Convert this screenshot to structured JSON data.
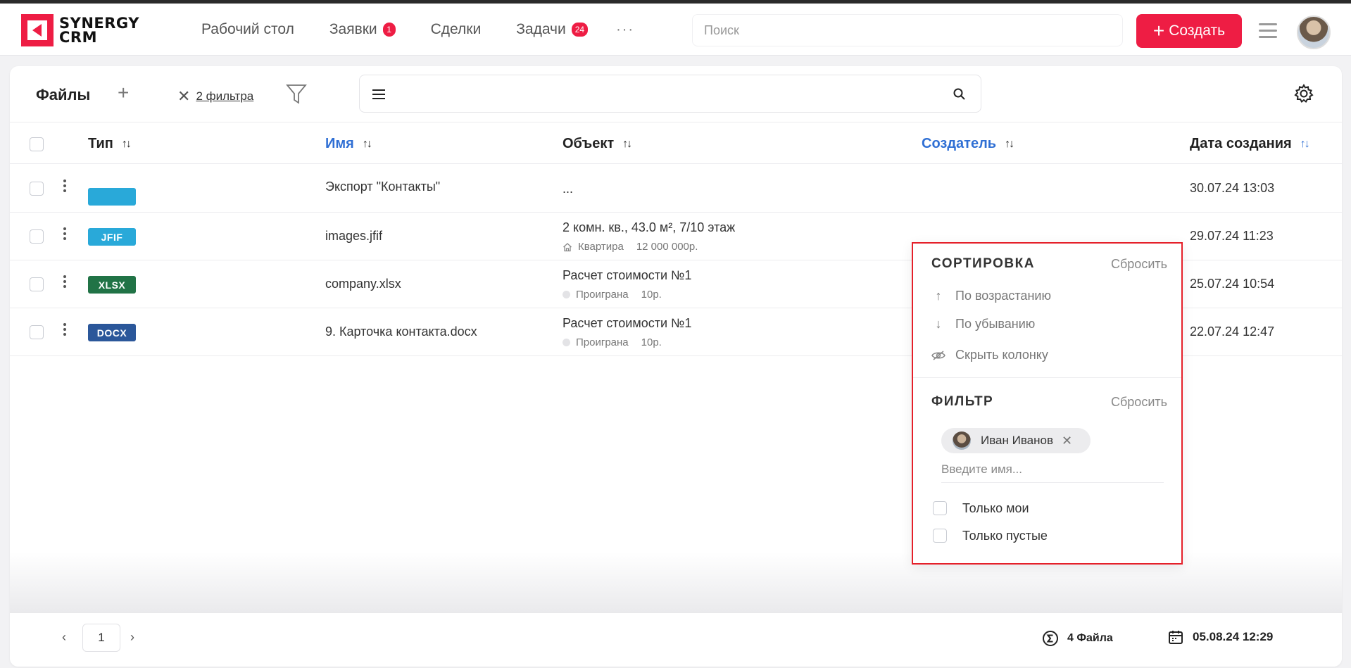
{
  "header": {
    "logo_line1": "SYNERGY",
    "logo_line2": "CRM",
    "nav": [
      {
        "label": "Рабочий стол",
        "badge": ""
      },
      {
        "label": "Заявки",
        "badge": "1"
      },
      {
        "label": "Сделки",
        "badge": ""
      },
      {
        "label": "Задачи",
        "badge": "24"
      }
    ],
    "more": "···",
    "search_placeholder": "Поиск",
    "create_label": "Создать"
  },
  "toolbar": {
    "title": "Файлы",
    "filters_label": "2 фильтра"
  },
  "table": {
    "columns": {
      "type": "Тип",
      "name": "Имя",
      "object": "Объект",
      "creator": "Создатель",
      "created": "Дата создания"
    },
    "rows": [
      {
        "type": "",
        "type_color": "#29a9d9",
        "name": "Экспорт \"Контакты\"",
        "object": "...",
        "sub_icon": "",
        "sub_status": "",
        "sub_value": "",
        "date": "30.07.24 13:03"
      },
      {
        "type": "JFIF",
        "type_color": "#29a9d9",
        "name": "images.jfif",
        "object": "2 комн. кв., 43.0 м², 7/10 этаж",
        "sub_icon": "house-icon",
        "sub_status": "Квартира",
        "sub_value": "12 000 000р.",
        "date": "29.07.24 11:23"
      },
      {
        "type": "XLSX",
        "type_color": "#217346",
        "name": "company.xlsx",
        "object": "Расчет стоимости №1",
        "sub_icon": "dot-icon",
        "sub_status": "Проиграна",
        "sub_value": "10р.",
        "date": "25.07.24 10:54"
      },
      {
        "type": "DOCX",
        "type_color": "#2b579a",
        "name": "9. Карточка контакта.docx",
        "object": "Расчет стоимости №1",
        "sub_icon": "dot-icon",
        "sub_status": "Проиграна",
        "sub_value": "10р.",
        "date": "22.07.24 12:47"
      }
    ]
  },
  "popup": {
    "sort_title": "СОРТИРОВКА",
    "reset": "Сбросить",
    "asc": "По возрастанию",
    "desc": "По убыванию",
    "hide": "Скрыть колонку",
    "filter_title": "ФИЛЬТР",
    "chip_name": "Иван Иванов",
    "name_placeholder": "Введите имя...",
    "only_mine": "Только мои",
    "only_empty": "Только пустые"
  },
  "footer": {
    "page": "1",
    "count": "4 Файла",
    "date": "05.08.24 12:29"
  },
  "colors": {
    "accent": "#ee1d44",
    "link_blue": "#2f6fd4",
    "highlight_border": "#e5202a"
  }
}
